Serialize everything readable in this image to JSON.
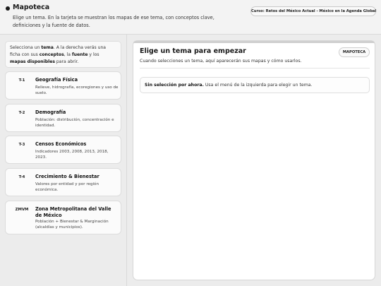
{
  "header": {
    "title": "Mapoteca",
    "subtitle": "Elige un tema. En la tarjeta se muestran los mapas de ese tema, con conceptos clave, definiciones y la fuente de datos.",
    "course_badge": "Curso: Retos del México Actual - México en la Agenda Global"
  },
  "sidebar": {
    "intro": {
      "p1": "Selecciona un ",
      "tema": "tema",
      "p2": ". A la derecha verás una ficha con sus ",
      "conceptos": "conceptos",
      "p3": ", la ",
      "fuente": "fuente",
      "p4": " y los ",
      "mapas": "mapas disponibles",
      "p5": " para abrir."
    },
    "topics": [
      {
        "code": "T-1",
        "name": "Geografía Física",
        "desc": "Relieve, hidrografía, ecoregiones y uso de suelo."
      },
      {
        "code": "T-2",
        "name": "Demografía",
        "desc": "Población: distribución, concentración e identidad."
      },
      {
        "code": "T-3",
        "name": "Censos Económicos",
        "desc": "Indicadores 2003, 2008, 2013, 2018, 2023."
      },
      {
        "code": "T-4",
        "name": "Crecimiento & Bienestar",
        "desc": "Valores por entidad y por región económica."
      },
      {
        "code": "ZMVM",
        "name": "Zona Metropolitana del Valle de México",
        "desc": "Población + Bienestar & Marginación (alcaldías y municipios)."
      }
    ]
  },
  "main": {
    "title": "Elige un tema para empezar",
    "badge": "MAPOTECA",
    "description": "Cuando selecciones un tema, aquí aparecerán sus mapas y cómo usarlos.",
    "notice_bold": "Sin selección por ahora.",
    "notice_text": " Usa el menú de la izquierda para elegir un tema."
  }
}
